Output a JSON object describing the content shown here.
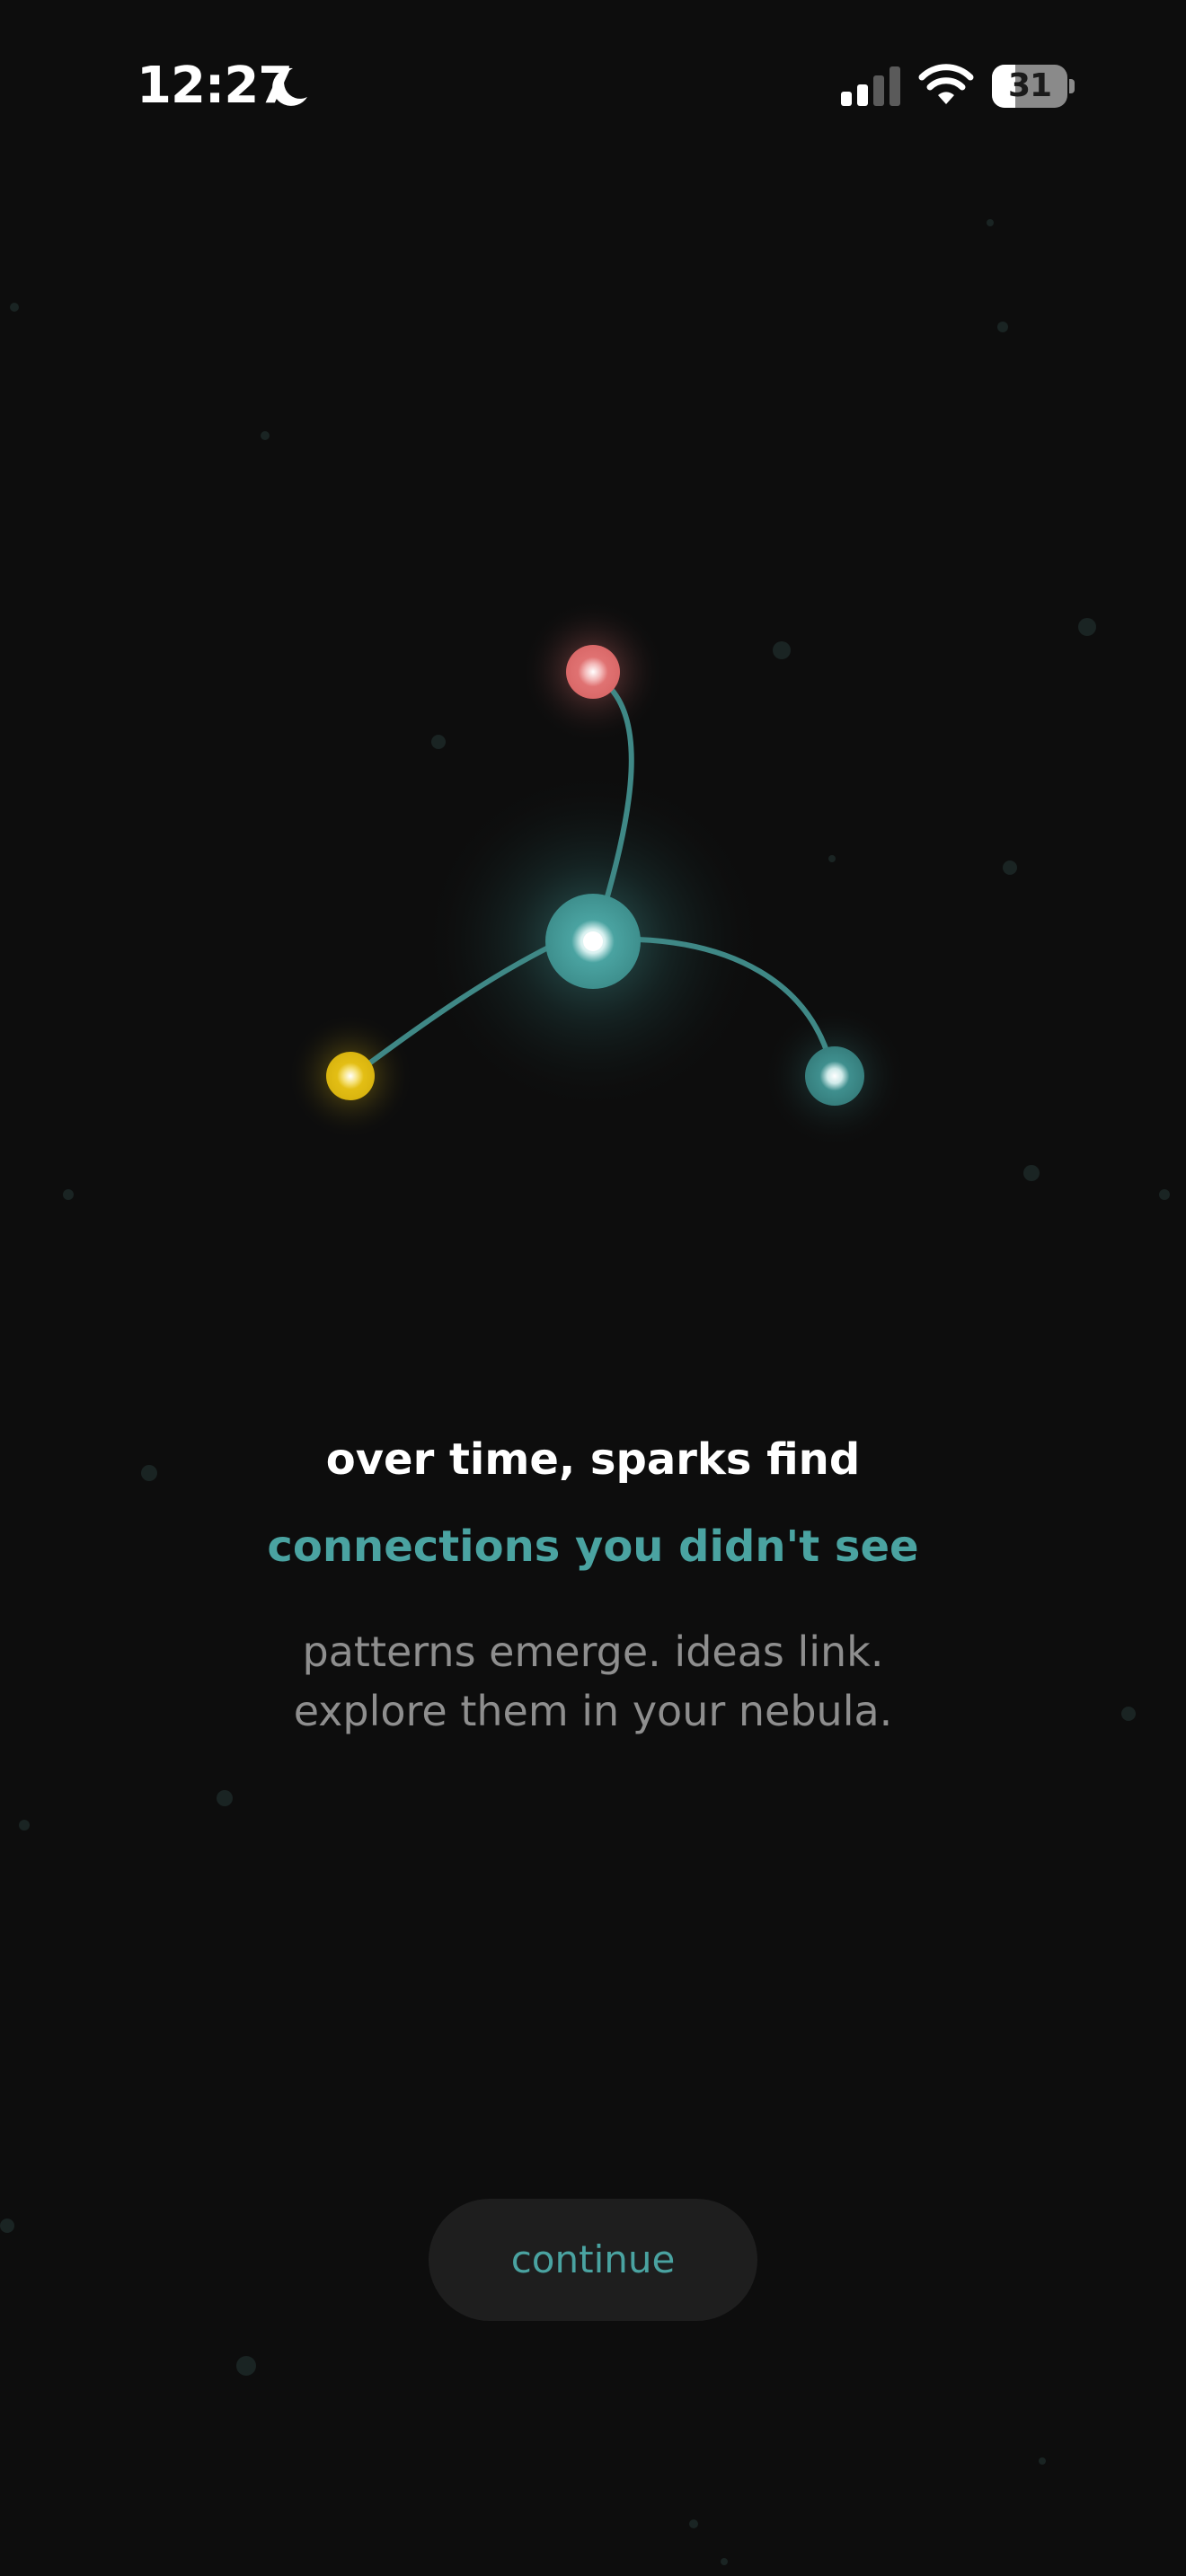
{
  "status_bar": {
    "time": "12:27",
    "battery_level": "31",
    "battery_fraction": 0.31,
    "icons": [
      "moon-icon",
      "cellular-signal-icon",
      "wifi-icon",
      "battery-icon"
    ]
  },
  "illustration": {
    "colors": {
      "core": "#4aa3a1",
      "red": "#e07272",
      "yellow": "#e3be14",
      "teal": "#3f8f8e",
      "line": "#3f8886"
    }
  },
  "onboarding": {
    "headline": "over time, sparks find",
    "headline_accent": "connections you didn't see",
    "description_lines": [
      "patterns emerge. ideas link.",
      "explore them in your nebula."
    ],
    "continue_label": "continue"
  },
  "colors": {
    "background": "#0d0d0d",
    "accent": "#4aa3a1",
    "text_primary": "#ffffff",
    "text_secondary": "#8e8e8e",
    "button_bg": "#1e1e1e"
  }
}
